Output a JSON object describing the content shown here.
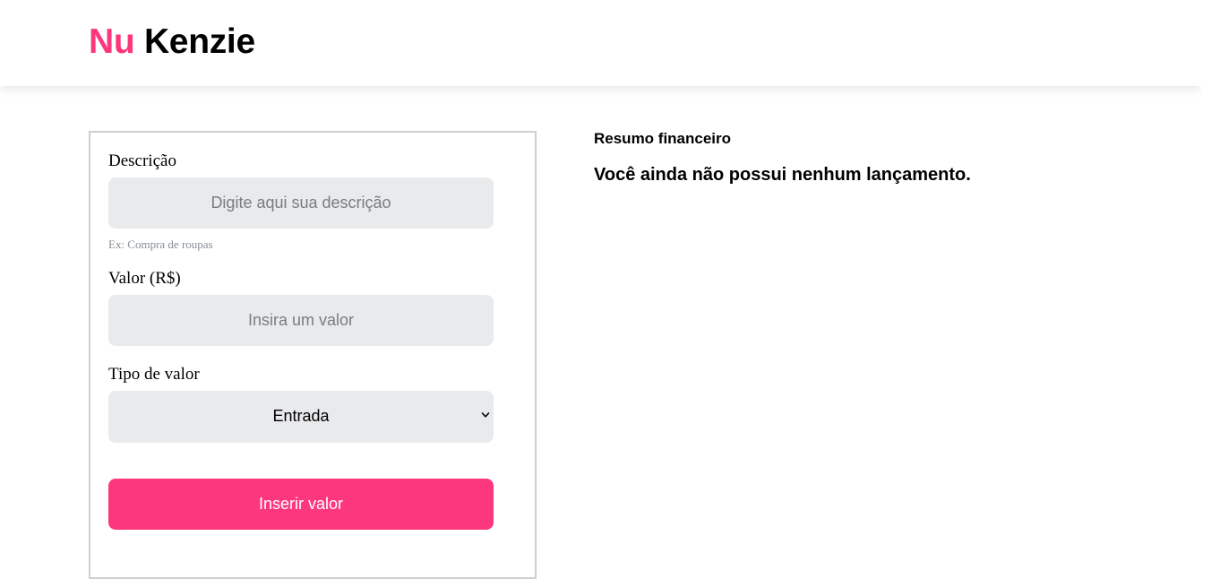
{
  "header": {
    "logo_part1": "Nu",
    "logo_part2": "Kenzie",
    "brand_color": "#fd377e"
  },
  "form": {
    "description_label": "Descrição",
    "description_placeholder": "Digite aqui sua descrição",
    "description_value": "",
    "description_hint": "Ex: Compra de roupas",
    "value_label": "Valor (R$)",
    "value_placeholder": "Insira um valor",
    "value_value": "",
    "type_label": "Tipo de valor",
    "type_selected": "Entrada",
    "submit_label": "Inserir valor"
  },
  "summary": {
    "title": "Resumo financeiro",
    "empty_message": "Você ainda não possui nenhum lançamento."
  }
}
